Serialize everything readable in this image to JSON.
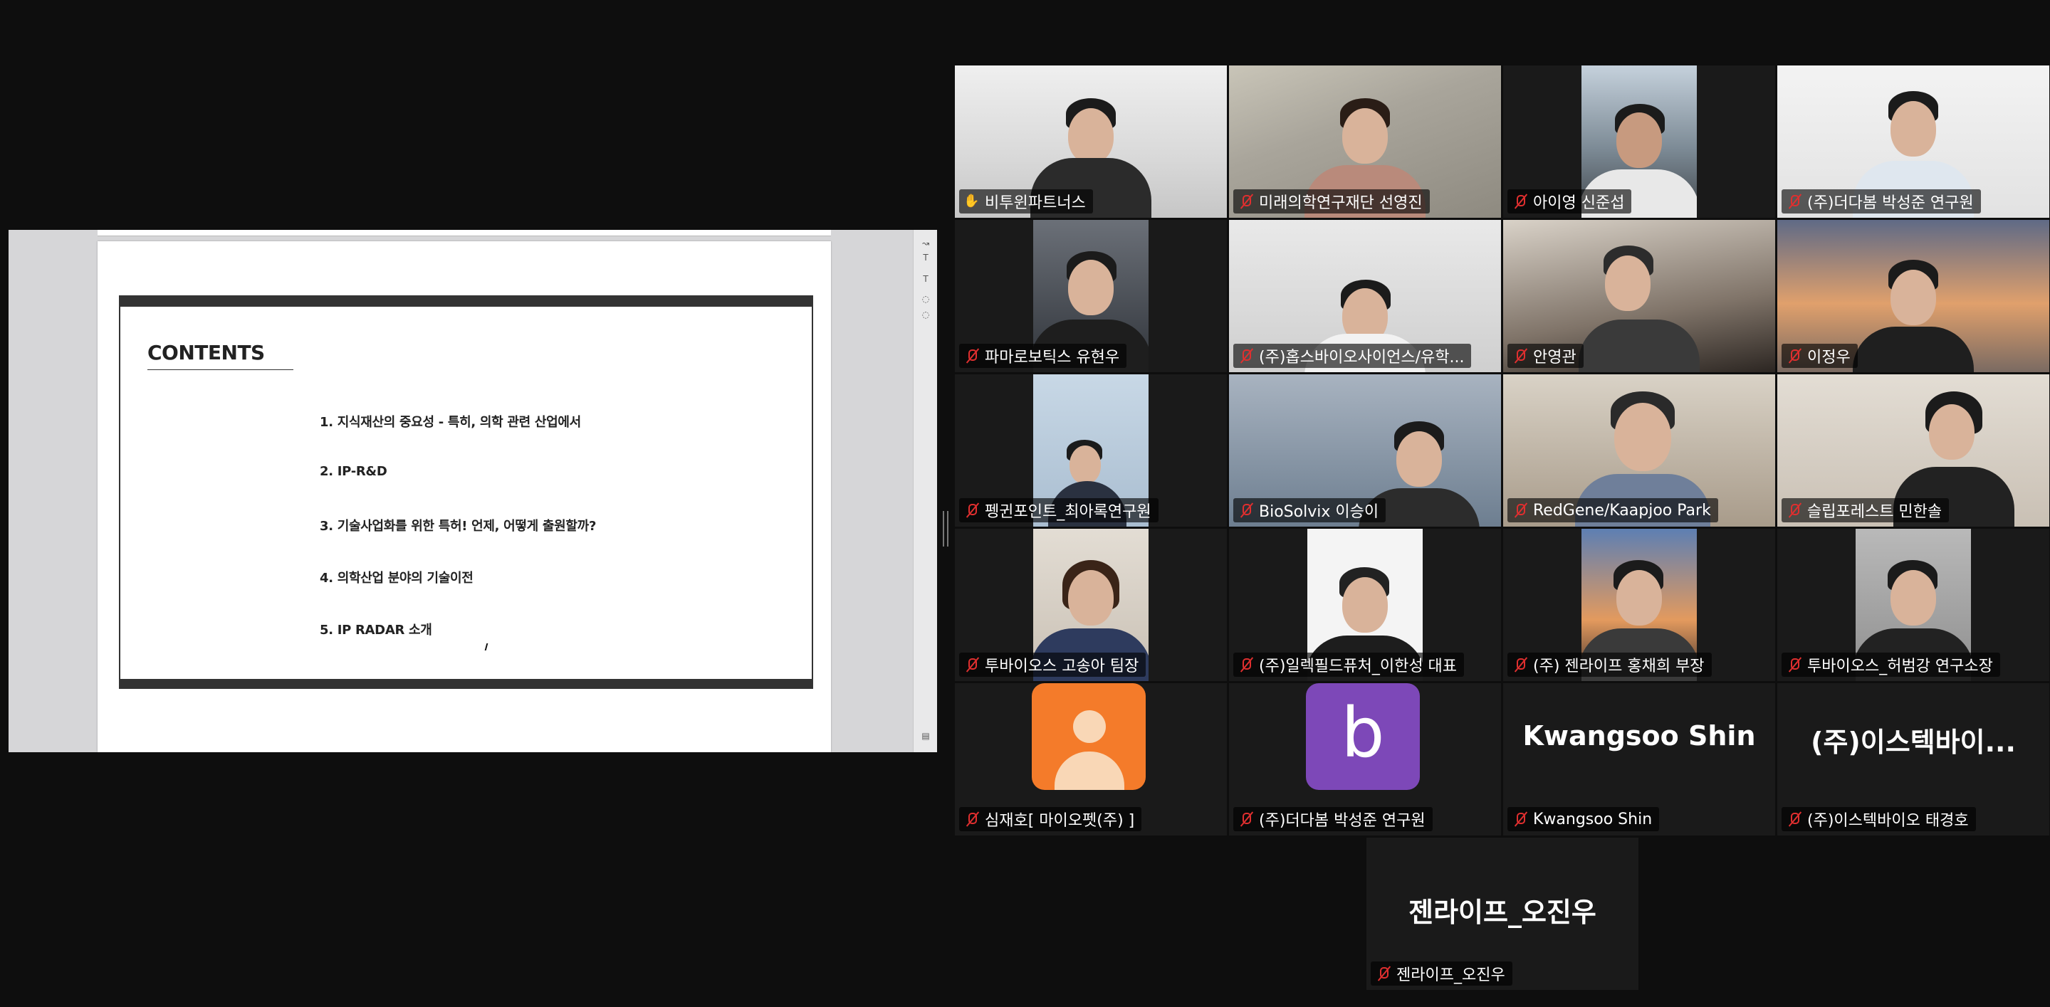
{
  "shared_slide": {
    "title": "CONTENTS",
    "toc": [
      "1.  지식재산의 중요성 - 특히, 의학 관련 산업에서",
      "2. IP-R&D",
      "3. 기술사업화를 위한 특허! 언제, 어떻게 출원할까?",
      "4. 의학산업 분야의 기술이전",
      "5. IP RADAR 소개"
    ],
    "rail_icons": [
      "share-icon",
      "text-icon",
      "text-icon",
      "comment-icon",
      "comment-icon",
      "page-icon"
    ]
  },
  "participants": [
    {
      "name": "비투윈파트너스",
      "status": "raised-hand",
      "speaking": true
    },
    {
      "name": "미래의학연구재단 선영진",
      "status": "muted"
    },
    {
      "name": "아이영 신준섭",
      "status": "muted"
    },
    {
      "name": "(주)더다봄 박성준 연구원",
      "status": "muted"
    },
    {
      "name": "파마로보틱스 유현우",
      "status": "muted"
    },
    {
      "name": "(주)홉스바이오사이언스/유학...",
      "status": "muted"
    },
    {
      "name": "안영관",
      "status": "muted"
    },
    {
      "name": "이정우",
      "status": "muted"
    },
    {
      "name": "펭귄포인트_최아록연구원",
      "status": "muted"
    },
    {
      "name": "BioSolvix  이승이",
      "status": "muted"
    },
    {
      "name": "RedGene/Kaapjoo Park",
      "status": "muted"
    },
    {
      "name": "슬립포레스트 민한솔",
      "status": "muted"
    },
    {
      "name": "투바이오스 고송아 팀장",
      "status": "muted"
    },
    {
      "name": "(주)일렉필드퓨처_이한성 대표",
      "status": "muted"
    },
    {
      "name": "(주) 젠라이프 홍채희 부장",
      "status": "muted"
    },
    {
      "name": "투바이오스_허범강 연구소장",
      "status": "muted"
    },
    {
      "name": "심재호[ 마이오펫(주) ]",
      "status": "muted",
      "avatar": "person"
    },
    {
      "name": "(주)더다봄 박성준 연구원",
      "status": "muted",
      "avatar": "letter",
      "avatar_letter": "b"
    },
    {
      "name": "Kwangsoo Shin",
      "status": "muted",
      "display": "Kwangsoo Shin"
    },
    {
      "name": "(주)이스텍바이오 태경호",
      "status": "muted",
      "display": "(주)이스텍바이..."
    },
    {
      "name": "젠라이프_오진우",
      "status": "muted",
      "display": "젠라이프_오진우"
    }
  ],
  "colors": {
    "speaking_outline": "#23d96b",
    "muted_icon": "#e02f2f",
    "avatar_orange": "#f47b2a",
    "avatar_purple": "#7d48b8"
  }
}
